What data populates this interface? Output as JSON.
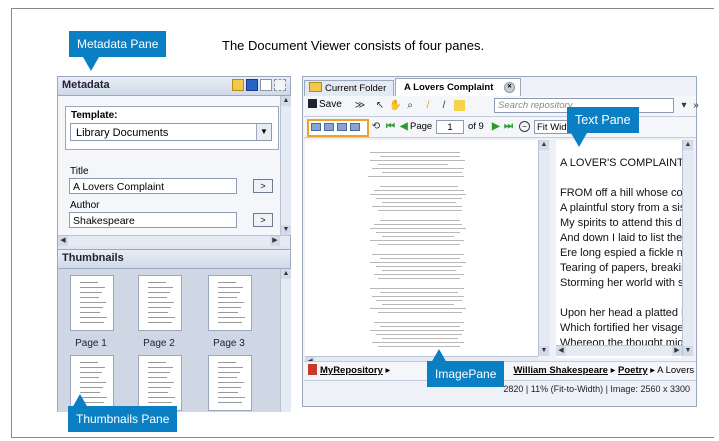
{
  "caption": "The Document Viewer consists of four panes.",
  "callouts": {
    "metadata": "Metadata Pane",
    "text": "Text Pane",
    "image": "ImagePane",
    "thumbnails": "Thumbnails Pane"
  },
  "metadata_pane": {
    "title": "Metadata",
    "template_label": "Template:",
    "template_value": "Library Documents",
    "fields": [
      {
        "label": "Title",
        "value": "A Lovers Complaint",
        "go": ">"
      },
      {
        "label": "Author",
        "value": "Shakespeare",
        "go": ">"
      }
    ]
  },
  "thumbnails_pane": {
    "title": "Thumbnails",
    "pages": [
      "Page 1",
      "Page 2",
      "Page 3"
    ]
  },
  "tabs": [
    {
      "label": "Current Folder"
    },
    {
      "label": "A Lovers Complaint"
    }
  ],
  "toolbar": {
    "save_label": "Save",
    "search_placeholder": "Search repository",
    "page_label": "Page",
    "page_value": "1",
    "page_total": "of 9",
    "fit_label": "Fit Width"
  },
  "text_pane": {
    "lines": [
      "A LOVER'S COMPLAINT",
      "",
      "FROM off a hill whose concave womb",
      "A plaintful story from a sistering vale,",
      "My spirits to attend this double voice accorded,",
      "And down I laid to list the sad-tuned tale;",
      "Ere long espied a fickle maid full pale,",
      "Tearing of papers, breaking rings a-twain,",
      "Storming her world with sorrow's wind and rain.",
      "",
      "Upon her head a platted hive of straw,",
      "Which fortified her visage from the sun,",
      "Whereon the thought might think sometime it saw"
    ]
  },
  "breadcrumb": {
    "items": [
      "MyRepository",
      "William Shakespeare",
      "Poetry",
      "A Lovers"
    ]
  },
  "status": "2820 | 11% (Fit-to-Width) | Image: 2560 x 3300",
  "colors": {
    "callout": "#0b7fc4",
    "panel_bg": "#dfe6f1",
    "highlight": "#f0a227",
    "nav_green": "#2c9b2c"
  }
}
